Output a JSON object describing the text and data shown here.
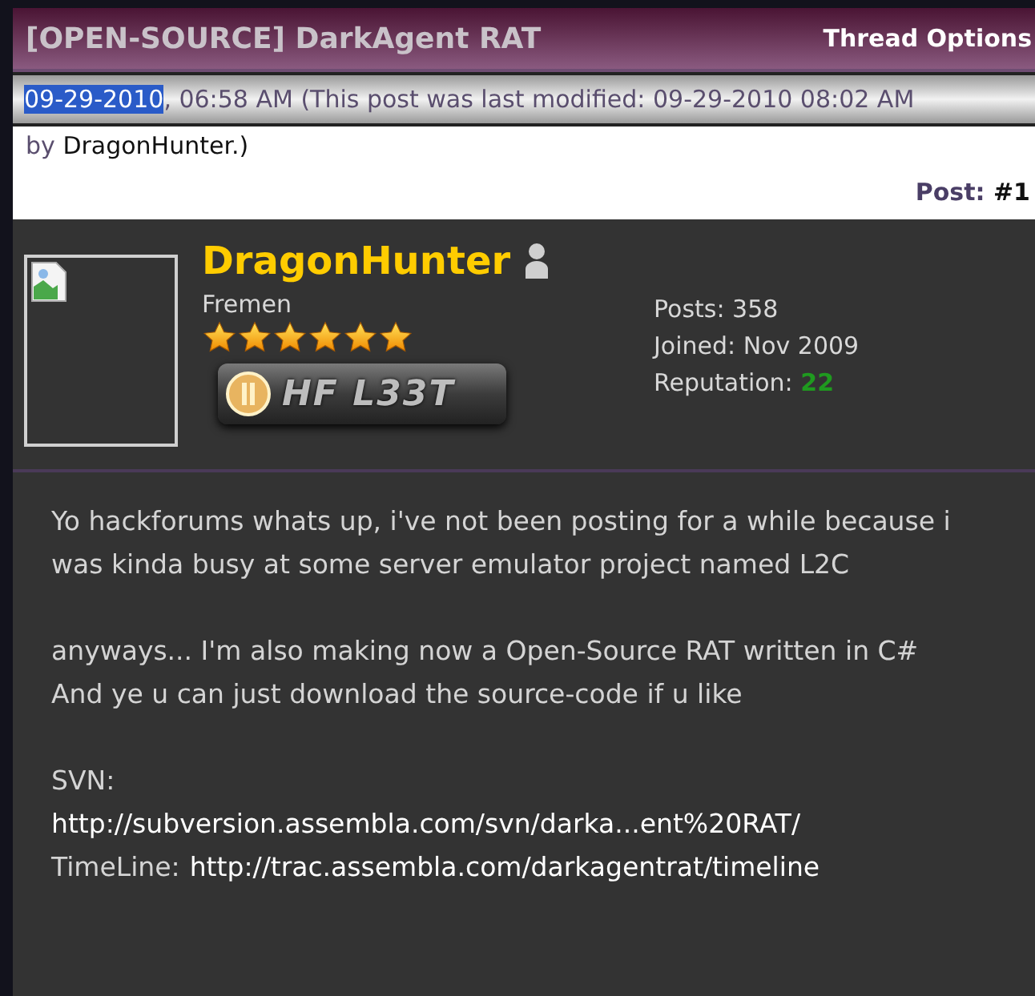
{
  "thread": {
    "title": "[OPEN-SOURCE] DarkAgent RAT",
    "options_link": "Thread Options"
  },
  "post_meta": {
    "date": "09-29-2010",
    "date_highlighted": true,
    "rest": ", 06:58 AM (This post was last modified: 09-29-2010 08:02 AM",
    "by_prefix": "by",
    "by_user": "DragonHunter.)",
    "post_label": "Post:",
    "post_number": "#1"
  },
  "author": {
    "name": "DragonHunter",
    "online": false,
    "title": "Fremen",
    "stars": 6,
    "userbar": "HF L33T",
    "stats": [
      {
        "label": "Posts:",
        "value": "358",
        "kind": "plain"
      },
      {
        "label": "Joined:",
        "value": "Nov 2009",
        "kind": "plain"
      },
      {
        "label": "Reputation:",
        "value": "22",
        "kind": "reputation"
      }
    ]
  },
  "body": [
    {
      "kind": "text",
      "text": "Yo hackforums whats up, i've not been posting for a while because i was kinda busy at some server emulator project named L2C"
    },
    {
      "kind": "gap"
    },
    {
      "kind": "text",
      "text": "anyways... I'm also making now a Open-Source RAT written in C#"
    },
    {
      "kind": "text",
      "text": "And ye u can just download the source-code if u like"
    },
    {
      "kind": "gap"
    },
    {
      "kind": "text",
      "text": "SVN:"
    },
    {
      "kind": "link",
      "text": "http://subversion.assembla.com/svn/darka...ent%20RAT/"
    },
    {
      "kind": "labeled_link",
      "label": "TimeLine:",
      "text": "http://trac.assembla.com/darkagentrat/timeline"
    }
  ]
}
